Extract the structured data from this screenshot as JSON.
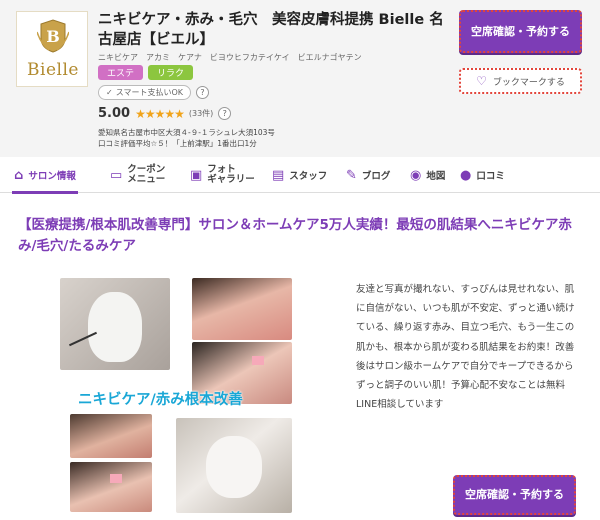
{
  "header": {
    "logo_text": "Bielle",
    "salon_name": "ニキビケア・赤み・毛穴　美容皮膚科提携 Bielle 名古屋店【ビエル】",
    "salon_kana": "ニキビケア　アカミ　ケアナ　ビヨウヒフカテイケイ　ビエルナゴヤテン",
    "tags": [
      "エステ",
      "リラク"
    ],
    "smartpay_label": "スマート支払いOK",
    "help_icon_text": "?",
    "rating_score": "5.00",
    "rating_stars": "★★★★★",
    "rating_count": "(33件)",
    "address": "愛知県名古屋市中区大須４-９-１ラシュレ大須103号",
    "access": "口コミ評価平均☆５！「上前津駅」1番出口1分",
    "reserve_label": "空席確認・予約する",
    "bookmark_label": "ブックマークする"
  },
  "nav": {
    "items": [
      {
        "label": "サロン情報",
        "icon": "home-icon"
      },
      {
        "label": "クーポン\nメニュー",
        "icon": "ticket-icon"
      },
      {
        "label": "フォト\nギャラリー",
        "icon": "photo-icon"
      },
      {
        "label": "スタッフ",
        "icon": "staff-icon"
      },
      {
        "label": "ブログ",
        "icon": "pen-icon"
      },
      {
        "label": "地図",
        "icon": "map-pin-icon"
      },
      {
        "label": "口コミ",
        "icon": "chat-icon"
      }
    ],
    "active": "サロン情報"
  },
  "main": {
    "headline": "【医療提携/根本肌改善専門】サロン＆ホームケア5万人実績！最短の肌結果へニキビケア赤み/毛穴/たるみケア",
    "image_caption": "ニキビケア/赤み根本改善",
    "description": "友達と写真が撮れない、すっぴんは見せれない、肌に自信がない、いつも肌が不安定、ずっと通い続けている、繰り返す赤み、目立つ毛穴、もう一生この肌かも、根本から肌が変わる肌結果をお約束！改善後はサロン級ホームケアで自分でキープできるからずっと調子のいい肌！予算心配不安なことは無料LINE相談しています",
    "reserve_label": "空席確認・予約する"
  },
  "colors": {
    "accent": "#7d3db6",
    "tag_este": "#d170c4",
    "tag_rira": "#8cc63f",
    "star": "#f0a31a",
    "caption": "#1aa7d6"
  }
}
